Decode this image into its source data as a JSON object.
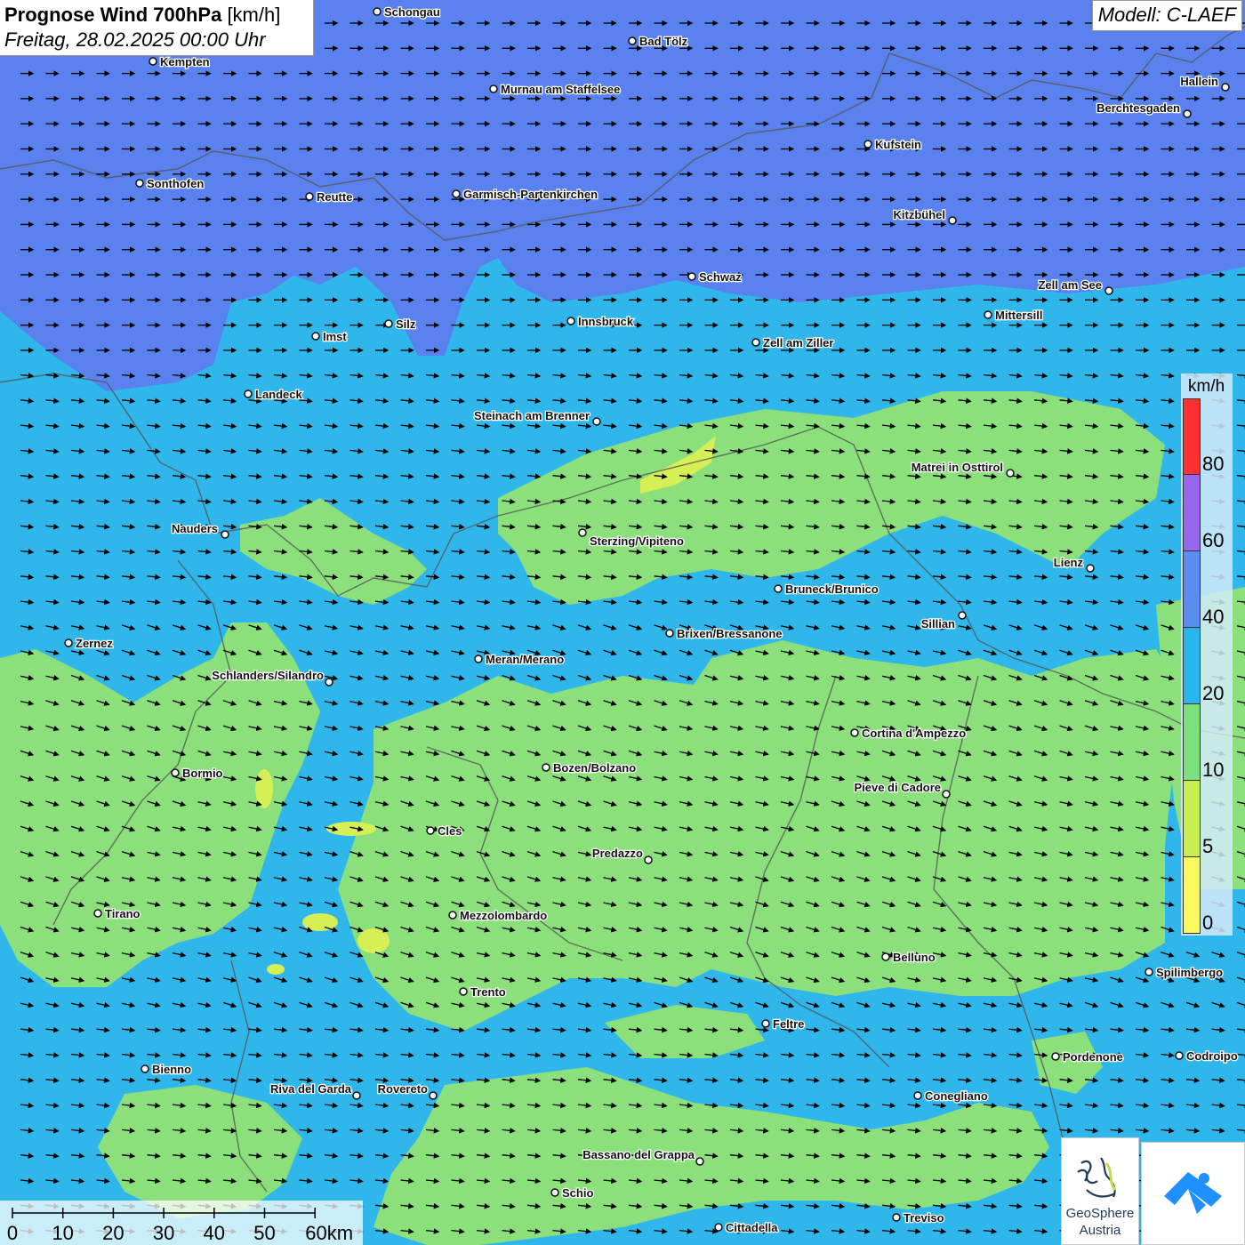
{
  "header": {
    "title_bold": "Prognose Wind 700hPa",
    "title_unit": "[km/h]",
    "datetime": "Freitag, 28.02.2025 00:00 Uhr",
    "model": "Modell: C-LAEF"
  },
  "legend": {
    "unit": "km/h",
    "ticks": [
      "80",
      "60",
      "40",
      "20",
      "10",
      "5",
      "0"
    ],
    "colors": [
      "#ff3030",
      "#9966ee",
      "#5b8cf0",
      "#29b6ec",
      "#7ee07a",
      "#c8ef50",
      "#f8f860"
    ]
  },
  "scale_bar": {
    "labels": [
      "0",
      "10",
      "20",
      "30",
      "40",
      "50",
      "60km"
    ]
  },
  "logos": {
    "geosphere_line1": "GeoSphere",
    "geosphere_line2": "Austria"
  },
  "map": {
    "field_colors": {
      "strong": "#5a82ee",
      "medium": "#2fb7ec",
      "light": "#8be07c",
      "calm": "#d6ef55"
    },
    "wind_direction": "from west",
    "cities": [
      {
        "name": "Schongau"
      },
      {
        "name": "Bad Tölz"
      },
      {
        "name": "Kempten"
      },
      {
        "name": "Murnau am Staffelsee"
      },
      {
        "name": "Hallein"
      },
      {
        "name": "Berchtesgaden"
      },
      {
        "name": "Kufstein"
      },
      {
        "name": "Sonthofen"
      },
      {
        "name": "Reutte"
      },
      {
        "name": "Garmisch-Partenkirchen"
      },
      {
        "name": "Kitzbühel"
      },
      {
        "name": "Schwaz"
      },
      {
        "name": "Zell am See"
      },
      {
        "name": "Mittersill"
      },
      {
        "name": "Innsbruck"
      },
      {
        "name": "Silz"
      },
      {
        "name": "Imst"
      },
      {
        "name": "Zell am Ziller"
      },
      {
        "name": "Landeck"
      },
      {
        "name": "Steinach am Brenner"
      },
      {
        "name": "Matrei in Osttirol"
      },
      {
        "name": "Nauders"
      },
      {
        "name": "Sterzing/Vipiteno"
      },
      {
        "name": "Lienz"
      },
      {
        "name": "Bruneck/Brunico"
      },
      {
        "name": "Sillian"
      },
      {
        "name": "Zernez"
      },
      {
        "name": "Brixen/Bressanone"
      },
      {
        "name": "Meran/Merano"
      },
      {
        "name": "Schlanders/Silandro"
      },
      {
        "name": "Cortina d'Ampezzo"
      },
      {
        "name": "Bozen/Bolzano"
      },
      {
        "name": "Bormio"
      },
      {
        "name": "Pieve di Cadore"
      },
      {
        "name": "Cles"
      },
      {
        "name": "Predazzo"
      },
      {
        "name": "Tirano"
      },
      {
        "name": "Mezzolombardo"
      },
      {
        "name": "Belluno"
      },
      {
        "name": "Spilimbergo"
      },
      {
        "name": "Trento"
      },
      {
        "name": "Feltre"
      },
      {
        "name": "Pordenone"
      },
      {
        "name": "Codroipo"
      },
      {
        "name": "Bienno"
      },
      {
        "name": "Riva del Garda"
      },
      {
        "name": "Rovereto"
      },
      {
        "name": "Conegliano"
      },
      {
        "name": "Bassano del Grappa"
      },
      {
        "name": "Schio"
      },
      {
        "name": "Treviso"
      },
      {
        "name": "Cittadella"
      }
    ]
  }
}
